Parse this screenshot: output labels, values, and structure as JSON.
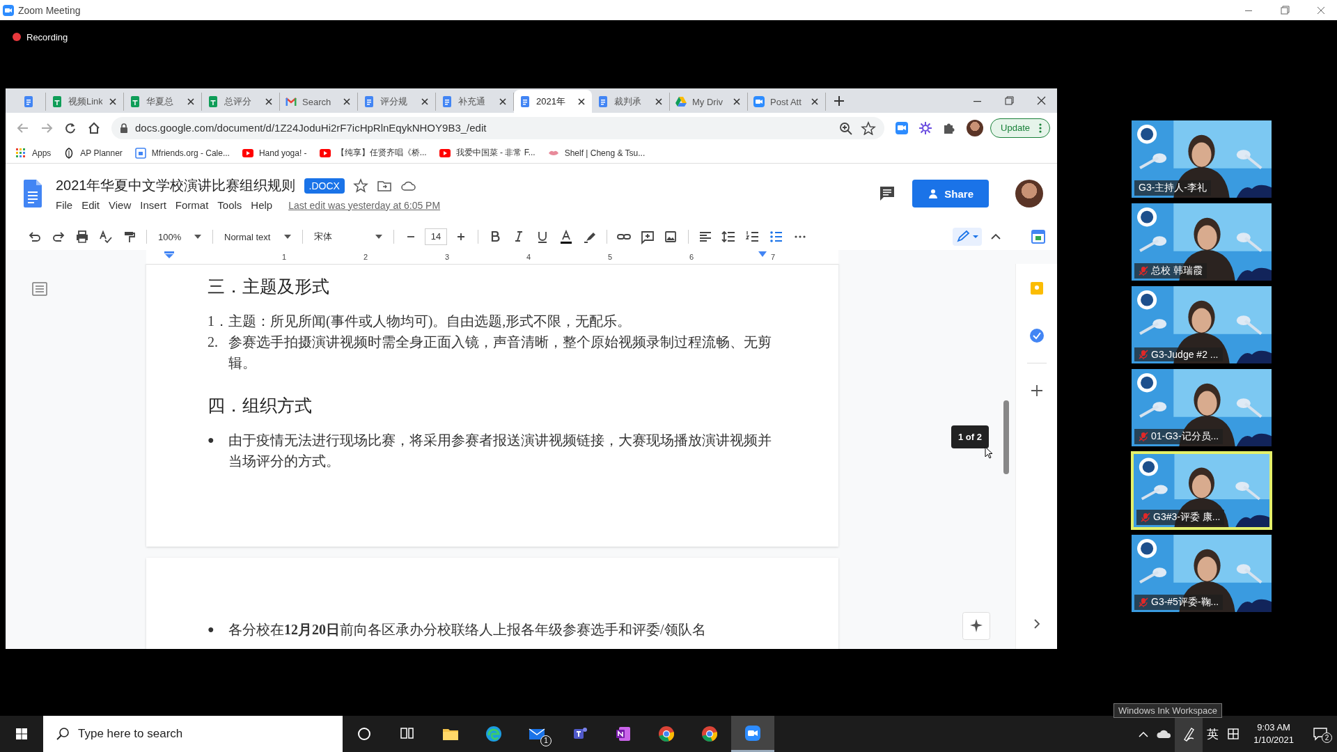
{
  "window": {
    "title": "Zoom Meeting"
  },
  "recording": {
    "label": "Recording",
    "on": true
  },
  "browser": {
    "tabs": [
      {
        "kind": "docs",
        "selected": false
      },
      {
        "label": "视频Link",
        "kind": "sheets",
        "selected": false
      },
      {
        "label": "华夏总",
        "kind": "sheets",
        "selected": false
      },
      {
        "label": "总评分",
        "kind": "sheets",
        "selected": false
      },
      {
        "label": "Search",
        "kind": "gmail",
        "selected": false
      },
      {
        "label": "评分规",
        "kind": "docs",
        "selected": false
      },
      {
        "label": "补充通",
        "kind": "docs",
        "selected": false
      },
      {
        "label": "2021年",
        "kind": "docs",
        "selected": true
      },
      {
        "label": "裁判承",
        "kind": "docs",
        "selected": false
      },
      {
        "label": "My Driv",
        "kind": "drive",
        "selected": false
      },
      {
        "label": "Post Att",
        "kind": "zoom",
        "selected": false
      }
    ],
    "url": "docs.google.com/document/d/1Z24JoduHi2rF7icHpRlnEqykNHOY9B3_/edit",
    "update_button": "Update",
    "bookmarks": [
      {
        "label": "Apps",
        "kind": "apps"
      },
      {
        "label": "AP Planner",
        "kind": "leaf"
      },
      {
        "label": "Mfriends.org - Cale...",
        "kind": "calendar"
      },
      {
        "label": "Hand yoga! -",
        "kind": "youtube"
      },
      {
        "label": "【纯享】任贤齐唱《桥...",
        "kind": "youtube"
      },
      {
        "label": "我爱中国菜 - 非常 F...",
        "kind": "youtube"
      },
      {
        "label": "Shelf | Cheng & Tsu...",
        "kind": "shelf"
      }
    ]
  },
  "docs": {
    "title": "2021年华夏中文学校演讲比赛组织规则",
    "badge": ".DOCX",
    "menu": [
      "File",
      "Edit",
      "View",
      "Insert",
      "Format",
      "Tools",
      "Help"
    ],
    "last_edit": "Last edit was yesterday at 6:05 PM",
    "share": "Share",
    "toolbar": {
      "zoom": "100%",
      "style": "Normal text",
      "font": "宋体",
      "size": "14"
    },
    "ruler": [
      "1",
      "2",
      "3",
      "4",
      "5",
      "6",
      "7"
    ],
    "page1": [
      {
        "kind": "heading",
        "text": "三．主题及形式"
      },
      {
        "kind": "numbered",
        "marker": "1．",
        "text": "主题：所见所闻(事件或人物均可)。自由选题,形式不限，无配乐。"
      },
      {
        "kind": "numbered",
        "marker": "2.",
        "text": "参赛选手拍摄演讲视频时需全身正面入镜，声音清晰，整个原始视频录制过程流畅、无剪辑。"
      },
      {
        "kind": "heading",
        "text": "四．组织方式"
      },
      {
        "kind": "bullet",
        "marker": "●",
        "text": "由于疫情无法进行现场比赛，将采用参赛者报送演讲视频链接，大赛现场播放演讲视频并当场评分的方式。"
      }
    ],
    "page2": [
      {
        "kind": "bullet",
        "marker": "●",
        "text": "各分校在**12月20日**前向各区承办分校联络人上报各年级参赛选手和评委/领队名"
      }
    ],
    "page_indicator": "1 of 2"
  },
  "participants": [
    {
      "name": "G3-主持人-李礼",
      "muted": false,
      "selected": false
    },
    {
      "name": "总校 韩瑞霞",
      "muted": true,
      "selected": false
    },
    {
      "name": "G3-Judge #2 ...",
      "muted": true,
      "selected": false
    },
    {
      "name": "01-G3-记分员...",
      "muted": true,
      "selected": false
    },
    {
      "name": "G3#3-评委 康...",
      "muted": true,
      "selected": true
    },
    {
      "name": "G3-#5评委-鞠...",
      "muted": true,
      "selected": false
    }
  ],
  "taskbar": {
    "search_placeholder": "Type here to search",
    "apps": [
      {
        "kind": "cortana",
        "selected": false
      },
      {
        "kind": "taskview",
        "selected": false
      },
      {
        "kind": "folder",
        "selected": false
      },
      {
        "kind": "edge",
        "selected": false
      },
      {
        "kind": "mail",
        "selected": false,
        "badge": "1"
      },
      {
        "kind": "teams",
        "selected": false
      },
      {
        "kind": "onenote",
        "selected": false
      },
      {
        "kind": "chrome",
        "selected": false
      },
      {
        "kind": "chrome",
        "selected": false
      },
      {
        "kind": "zoom",
        "selected": true
      }
    ],
    "tooltip": "Windows Ink Workspace",
    "ime": "英",
    "time": "9:03 AM",
    "date": "1/10/2021",
    "notifications": "2"
  }
}
